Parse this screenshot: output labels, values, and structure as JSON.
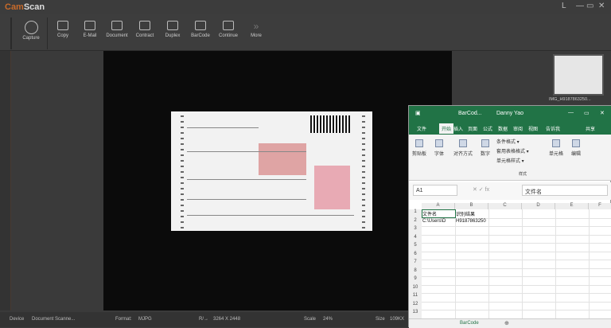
{
  "app": {
    "logo_prefix": "Cam",
    "logo_suffix": "Scan",
    "minimize": "L",
    "restore": "—",
    "max": "▭",
    "close": "✕"
  },
  "toolbar": [
    {
      "label": "Capture",
      "icon": "camera-circle-icon"
    },
    {
      "label": "Copy",
      "icon": "copy-icon"
    },
    {
      "label": "E-Mail",
      "icon": "mail-icon"
    },
    {
      "label": "Document",
      "icon": "document-icon"
    },
    {
      "label": "Contract",
      "icon": "camera-icon"
    },
    {
      "label": "Duplex",
      "icon": "duplex-icon"
    },
    {
      "label": "BarCode",
      "icon": "barcode-icon"
    },
    {
      "label": "Continue",
      "icon": "continue-icon"
    },
    {
      "label": "More",
      "icon": "chevron-double-right-icon"
    }
  ],
  "thumbnail": {
    "label": "IMG_H9187863250..."
  },
  "status": {
    "device_label": "Device",
    "device": "Document Scanne...",
    "format_label": "Format:",
    "format": "MJPG",
    "res_label": "R/→",
    "res": "3264 X 2448",
    "scale_label": "Scale",
    "scale": "24%",
    "size_label": "Size",
    "size": "109KX"
  },
  "excel": {
    "title": "BarCod...",
    "user": "Danny Yao",
    "tabs": [
      "文件",
      "开始",
      "插入",
      "页面",
      "公式",
      "数据",
      "审阅",
      "视图",
      "告诉我",
      "共享"
    ],
    "ribbon": {
      "paste": "剪贴板",
      "font": "字体",
      "align": "对齐方式",
      "number": "数字",
      "cond": "条件格式 ▾",
      "table": "套用表格格式 ▾",
      "cellstyle": "单元格样式 ▾",
      "styles": "样式",
      "cells": "单元格",
      "edit": "编辑"
    },
    "namebox": "A1",
    "formula": "文件名",
    "columns": [
      "A",
      "B",
      "C",
      "D",
      "E",
      "F"
    ],
    "rows": [
      "1",
      "2",
      "3",
      "4",
      "5",
      "6",
      "7",
      "8",
      "9",
      "10",
      "11",
      "12",
      "13"
    ],
    "cells": {
      "a1": "文件名",
      "b1": "识别结果",
      "a2": "C:\\Users\\D",
      "b2": "H9187863250"
    },
    "sheet": "BarCode",
    "accent": "#217346"
  }
}
